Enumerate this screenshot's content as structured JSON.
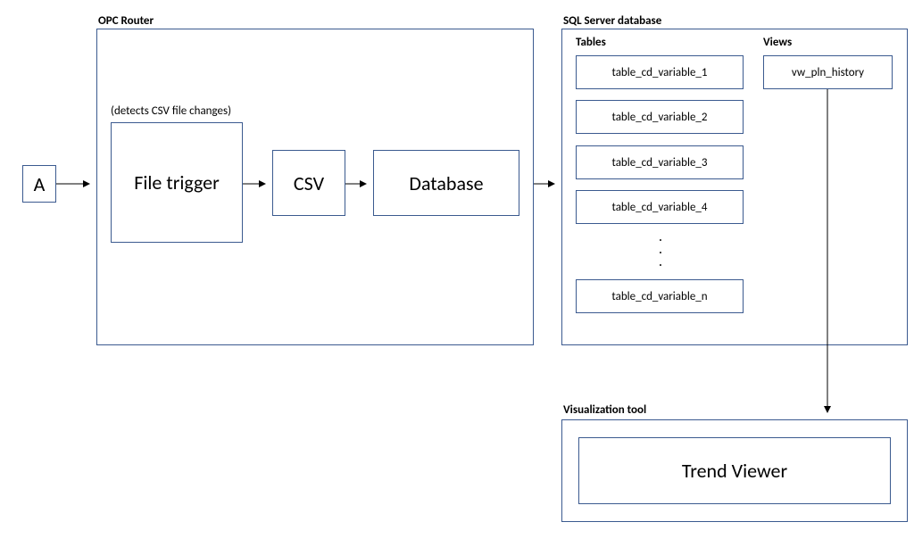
{
  "source": {
    "label": "A"
  },
  "opc": {
    "title": "OPC Router",
    "note": "(detects CSV file changes)",
    "file_trigger": "File trigger",
    "csv": "CSV",
    "database": "Database"
  },
  "sql": {
    "title": "SQL Server database",
    "tables_title": "Tables",
    "views_title": "Views",
    "tables": [
      "table_cd_variable_1",
      "table_cd_variable_2",
      "table_cd_variable_3",
      "table_cd_variable_4",
      "table_cd_variable_n"
    ],
    "view": "vw_pln_history"
  },
  "viz": {
    "title": "Visualization tool",
    "trend_viewer": "Trend Viewer"
  }
}
